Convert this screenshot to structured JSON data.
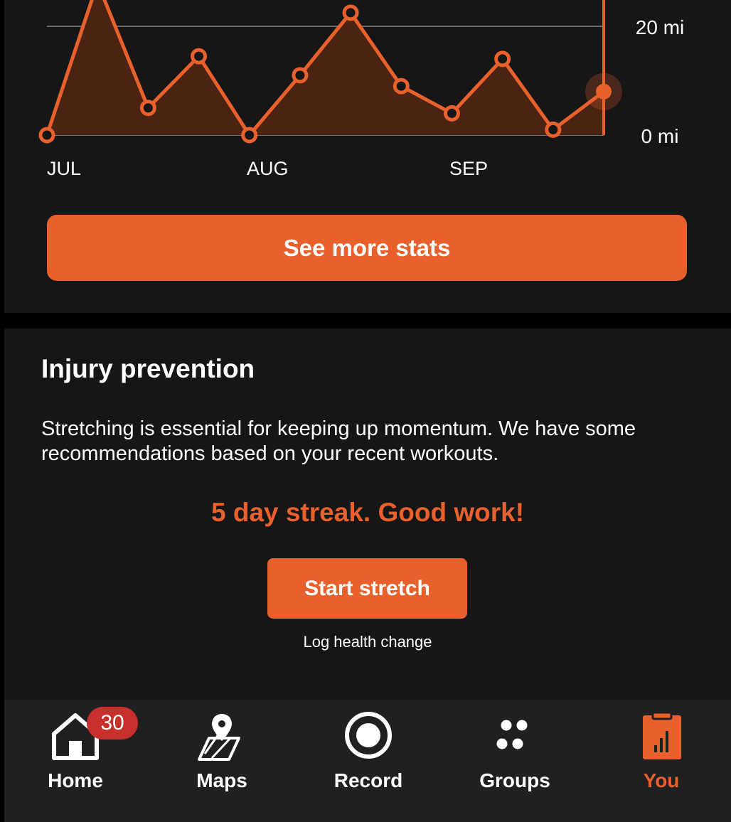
{
  "chart_data": {
    "type": "area",
    "x_tick_labels": [
      "JUL",
      "AUG",
      "SEP"
    ],
    "y_tick_labels": [
      "20 mi",
      "0 mi"
    ],
    "y_ticks": [
      20,
      0
    ],
    "ylim": [
      0,
      20
    ],
    "points": [
      0,
      28,
      5,
      14.5,
      0,
      11,
      22.5,
      9,
      4,
      14,
      1,
      8
    ],
    "accent_color": "#e8602c",
    "fill_color": "#4a2312"
  },
  "buttons": {
    "see_more": "See more stats",
    "start_stretch": "Start stretch",
    "log_health": "Log health change"
  },
  "injury": {
    "title": "Injury prevention",
    "description": "Stretching is essential for keeping up momentum. We have some recommendations based on your recent workouts.",
    "streak": "5 day streak. Good work!"
  },
  "tabs": [
    {
      "label": "Home",
      "icon": "home-icon",
      "badge": "30"
    },
    {
      "label": "Maps",
      "icon": "map-icon"
    },
    {
      "label": "Record",
      "icon": "record-icon"
    },
    {
      "label": "Groups",
      "icon": "groups-icon"
    },
    {
      "label": "You",
      "icon": "you-icon",
      "active": true
    }
  ]
}
